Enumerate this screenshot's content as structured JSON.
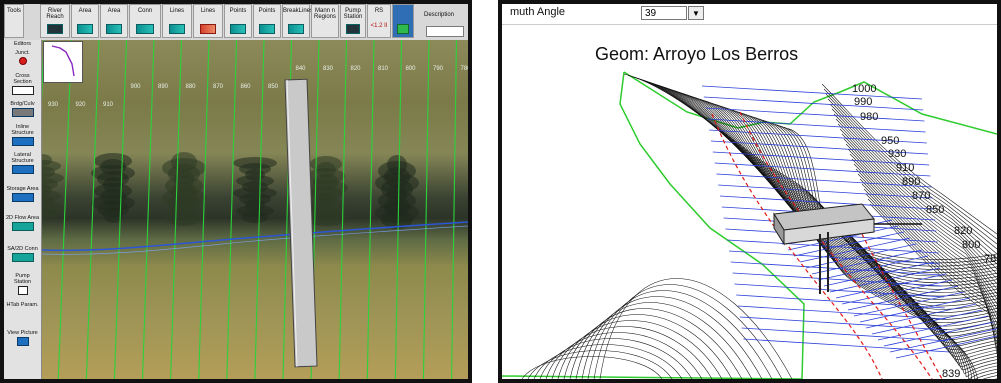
{
  "left": {
    "toolbar": {
      "buttons": [
        {
          "id": "tools",
          "label": "Tools"
        },
        {
          "id": "reach",
          "label": "River Reach"
        },
        {
          "id": "area",
          "label": "Area"
        },
        {
          "id": "storage_area",
          "label": "Area"
        },
        {
          "id": "sa2d_conn",
          "label": "Conn"
        },
        {
          "id": "lines",
          "label": "Lines"
        },
        {
          "id": "lines2",
          "label": "Lines"
        },
        {
          "id": "points",
          "label": "Points"
        },
        {
          "id": "points2",
          "label": "Points"
        },
        {
          "id": "breaklines",
          "label": "BreakLines"
        },
        {
          "id": "manning",
          "label": "Mann n Regions"
        },
        {
          "id": "pump",
          "label": "Pump Station"
        },
        {
          "id": "rs",
          "label": "RS"
        },
        {
          "id": "rs_value",
          "label": "<1.2 II"
        },
        {
          "id": "description",
          "label": "Description"
        }
      ]
    },
    "editors": {
      "title": "Editors",
      "items": [
        {
          "id": "junct",
          "label": "Junct."
        },
        {
          "id": "cross_section",
          "label": "Cross Section"
        },
        {
          "id": "brdg_culv",
          "label": "Brdg/Culv"
        },
        {
          "id": "inline",
          "label": "Inline Structure"
        },
        {
          "id": "lateral",
          "label": "Lateral Structure"
        },
        {
          "id": "storage",
          "label": "Storage Area"
        },
        {
          "id": "flow2d",
          "label": "2D Flow Area"
        },
        {
          "id": "sa2d",
          "label": "SA/2D Conn"
        },
        {
          "id": "pump",
          "label": "Pump Station"
        },
        {
          "id": "htab",
          "label": "HTab Param."
        },
        {
          "id": "view_picture",
          "label": "View Picture"
        }
      ]
    },
    "xs_labels": [
      "930",
      "920",
      "910",
      "900",
      "890",
      "880",
      "870",
      "860",
      "850",
      "840",
      "830",
      "820",
      "810",
      "800",
      "790",
      "780"
    ]
  },
  "right": {
    "header": {
      "label": "muth Angle",
      "value": "39",
      "dropdown": "▼"
    },
    "title": "Geom: Arroyo Los Berros",
    "xs_labels": [
      "1000",
      "990",
      "980",
      "950",
      "930",
      "910",
      "890",
      "870",
      "850",
      "820",
      "800",
      "78",
      "839"
    ]
  }
}
